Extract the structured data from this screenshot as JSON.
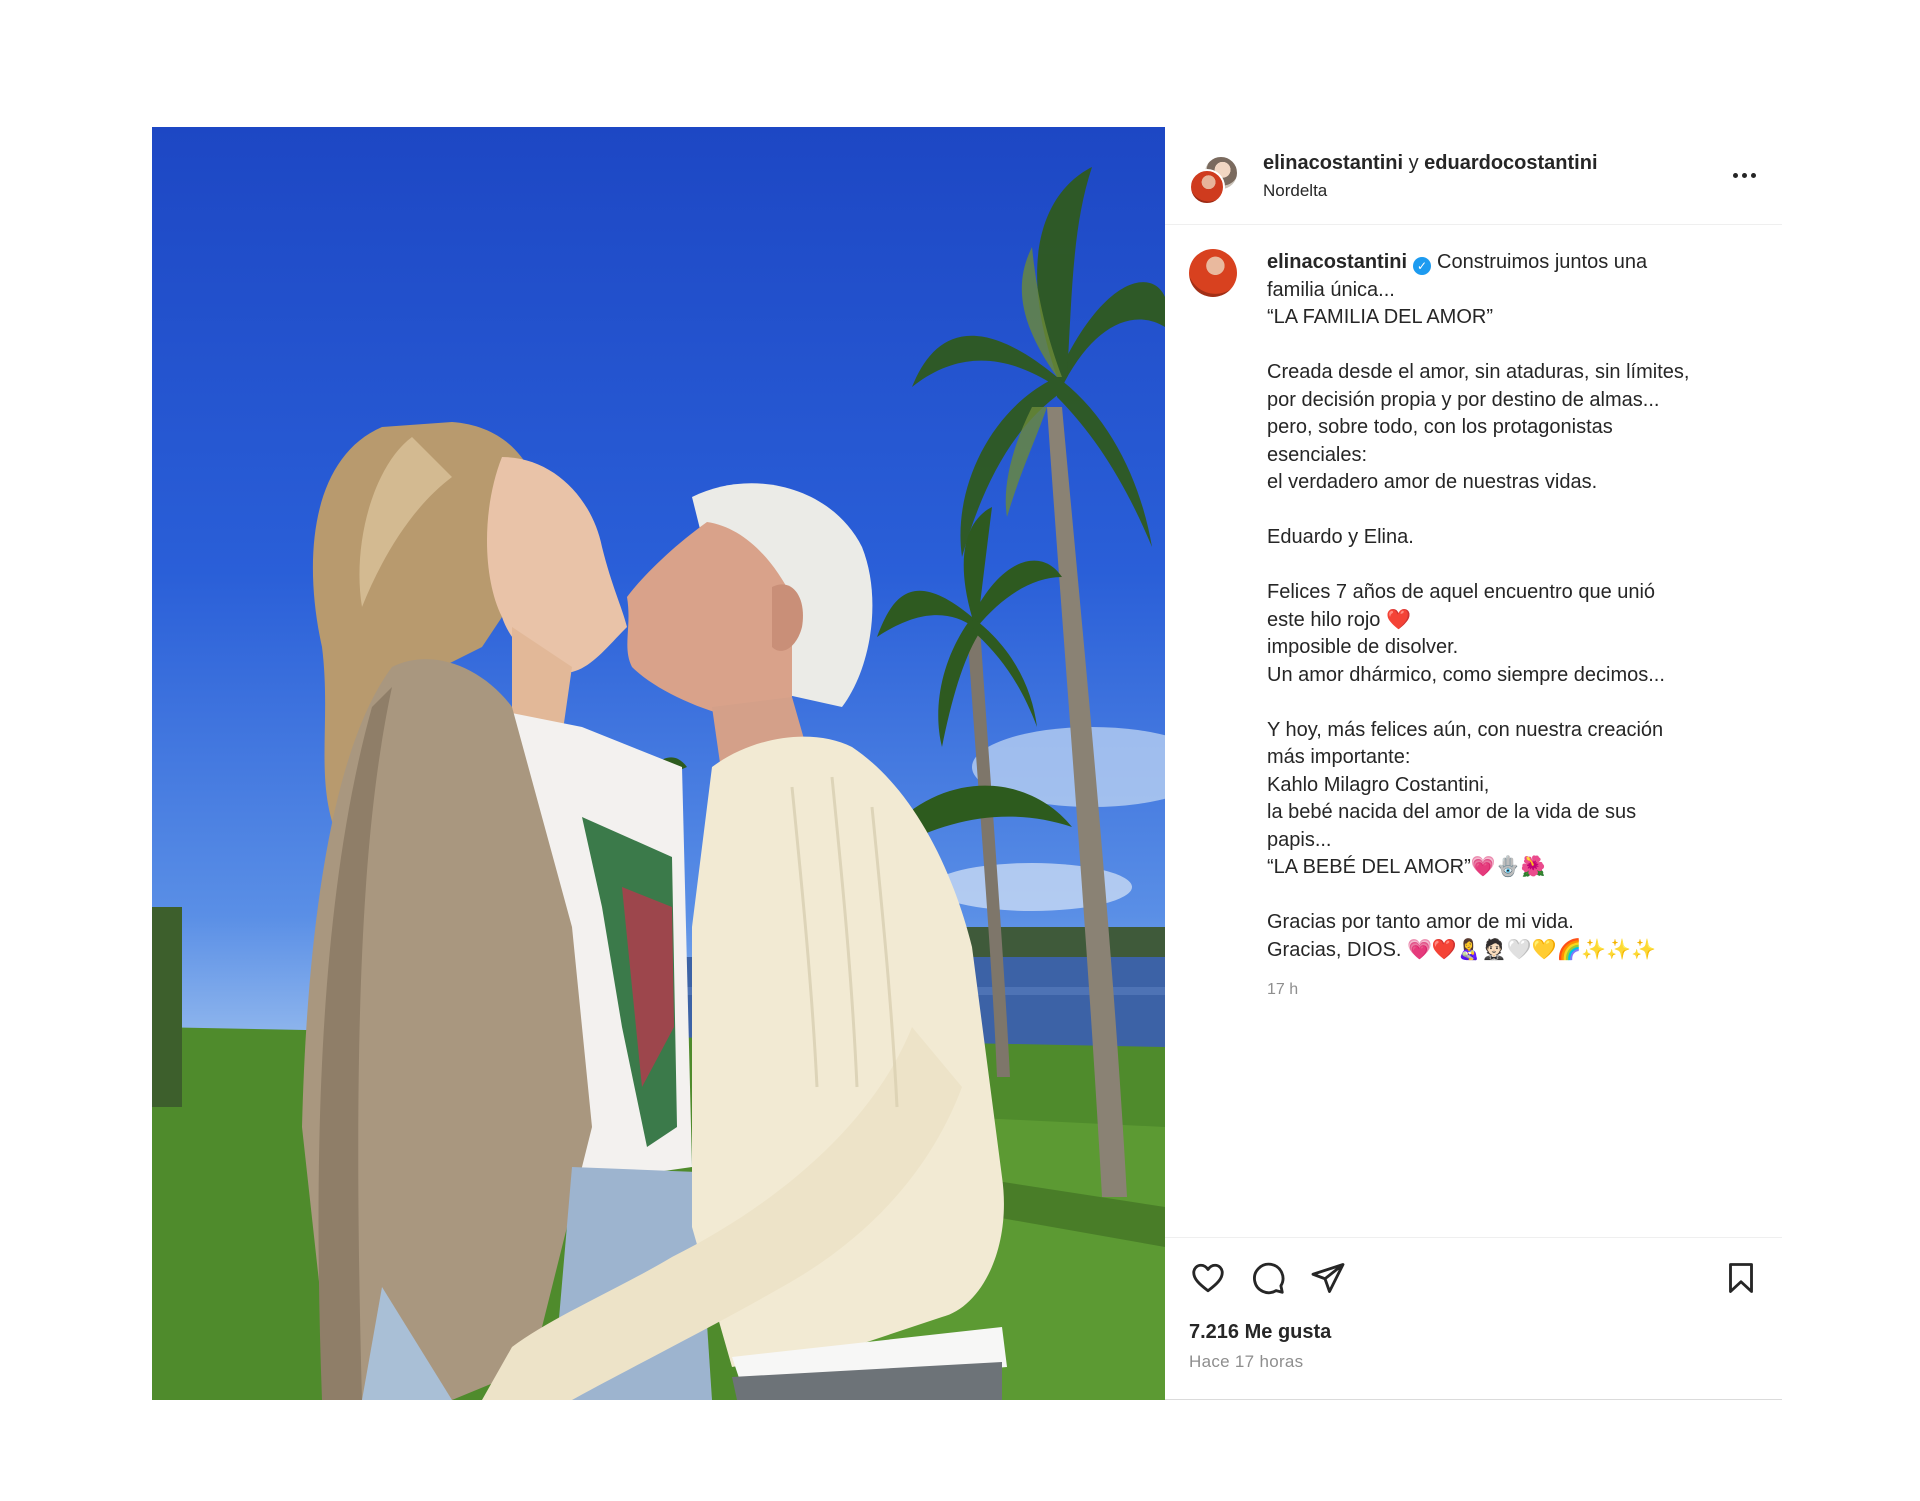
{
  "post": {
    "header": {
      "user1": "elinacostantini",
      "connector": " y ",
      "user2": "eduardocostantini",
      "location": "Nordelta"
    },
    "caption": {
      "username": "elinacostantini",
      "first_line": "Construimos juntos una",
      "lines": [
        "familia única...",
        "“LA FAMILIA DEL AMOR”",
        "",
        "Creada desde el amor, sin ataduras, sin límites,",
        "por decisión propia y por destino de almas...",
        "pero, sobre todo, con los protagonistas",
        "esenciales:",
        "el verdadero amor de nuestras vidas.",
        "",
        "Eduardo y Elina.",
        "",
        "Felices 7 años de aquel encuentro que unió",
        "este hilo rojo ❤️",
        "imposible de disolver.",
        "Un amor dhármico, como siempre decimos...",
        "",
        "Y hoy, más felices aún, con nuestra creación",
        "más importante:",
        "Kahlo Milagro Costantini,",
        "la bebé nacida del amor de la vida de sus",
        "papis...",
        "“LA BEBÉ DEL AMOR”💗🪬🌺",
        "",
        "Gracias por tanto amor de mi vida.",
        "Gracias, DIOS. 💗❤️👩‍🍼🤵🏻🤍💛🌈✨✨✨"
      ],
      "time": "17 h"
    },
    "likes": "7.216 Me gusta",
    "posted": "Hace 17 horas"
  }
}
